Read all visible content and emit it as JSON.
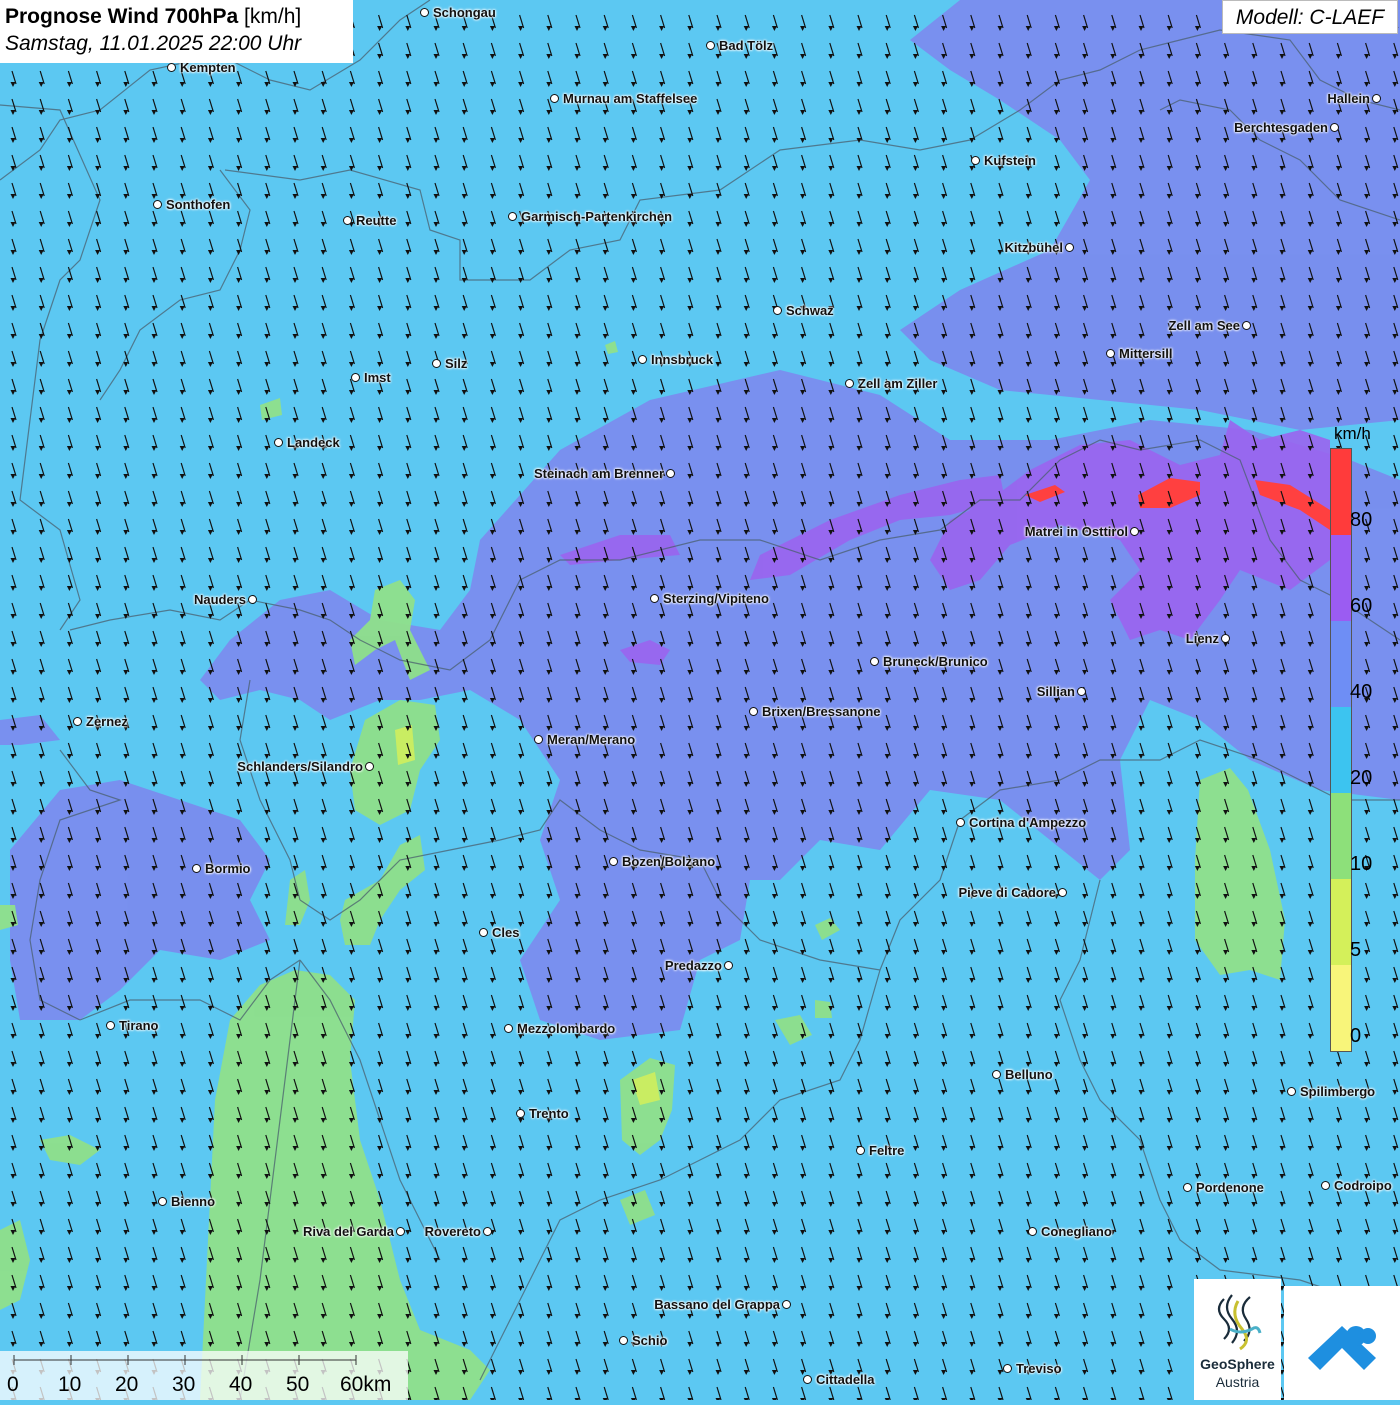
{
  "header": {
    "title_bold": "Prognose Wind 700hPa",
    "title_unit": "[km/h]",
    "datetime": "Samstag, 11.01.2025 22:00 Uhr"
  },
  "model": {
    "label": "Modell: C-LAEF"
  },
  "legend": {
    "unit": "km/h",
    "ticks": [
      "80",
      "60",
      "40",
      "20",
      "10",
      "5",
      "0"
    ],
    "colors": [
      "#ff3b3b",
      "#9b5cf2",
      "#6e8ef5",
      "#3cc4f0",
      "#8de07a",
      "#d4f05a",
      "#f8f57a"
    ]
  },
  "scale_bar": {
    "labels": [
      "0",
      "10",
      "20",
      "30",
      "40",
      "50",
      "60km"
    ]
  },
  "logos": {
    "geosphere_line1": "GeoSphere",
    "geosphere_line2": "Austria"
  },
  "colors": {
    "background": "#5cc8f2",
    "calm": "#8fe08a",
    "moderate": "#7e86ee",
    "strong": "#9966ee",
    "extreme": "#ff3b3b"
  },
  "cities": [
    {
      "name": "Schongau"
    },
    {
      "name": "Bad Tölz"
    },
    {
      "name": "Kempten"
    },
    {
      "name": "Murnau am Staffelsee"
    },
    {
      "name": "Hallein"
    },
    {
      "name": "Berchtesgaden"
    },
    {
      "name": "Kufstein"
    },
    {
      "name": "Sonthofen"
    },
    {
      "name": "Reutte"
    },
    {
      "name": "Garmisch-Partenkirchen"
    },
    {
      "name": "Kitzbühel"
    },
    {
      "name": "Schwaz"
    },
    {
      "name": "Zell am See"
    },
    {
      "name": "Mittersill"
    },
    {
      "name": "Silz"
    },
    {
      "name": "Innsbruck"
    },
    {
      "name": "Imst"
    },
    {
      "name": "Zell am Ziller"
    },
    {
      "name": "Landeck"
    },
    {
      "name": "Steinach am Brenner"
    },
    {
      "name": "Matrei in Osttirol"
    },
    {
      "name": "Nauders"
    },
    {
      "name": "Sterzing/Vipiteno"
    },
    {
      "name": "Lienz"
    },
    {
      "name": "Bruneck/Brunico"
    },
    {
      "name": "Sillian"
    },
    {
      "name": "Zernez"
    },
    {
      "name": "Brixen/Bressanone"
    },
    {
      "name": "Meran/Merano"
    },
    {
      "name": "Schlanders/Silandro"
    },
    {
      "name": "Cortina d'Ampezzo"
    },
    {
      "name": "Bozen/Bolzano"
    },
    {
      "name": "Bormio"
    },
    {
      "name": "Pieve di Cadore"
    },
    {
      "name": "Cles"
    },
    {
      "name": "Predazzo"
    },
    {
      "name": "Tirano"
    },
    {
      "name": "Mezzolombardo"
    },
    {
      "name": "Belluno"
    },
    {
      "name": "Spilimbergo"
    },
    {
      "name": "Trento"
    },
    {
      "name": "Feltre"
    },
    {
      "name": "Pordenone"
    },
    {
      "name": "Codroipo"
    },
    {
      "name": "Bienno"
    },
    {
      "name": "Riva del Garda"
    },
    {
      "name": "Rovereto"
    },
    {
      "name": "Conegliano"
    },
    {
      "name": "Bassano del Grappa"
    },
    {
      "name": "Schio"
    },
    {
      "name": "Treviso"
    },
    {
      "name": "Cittadella"
    }
  ]
}
